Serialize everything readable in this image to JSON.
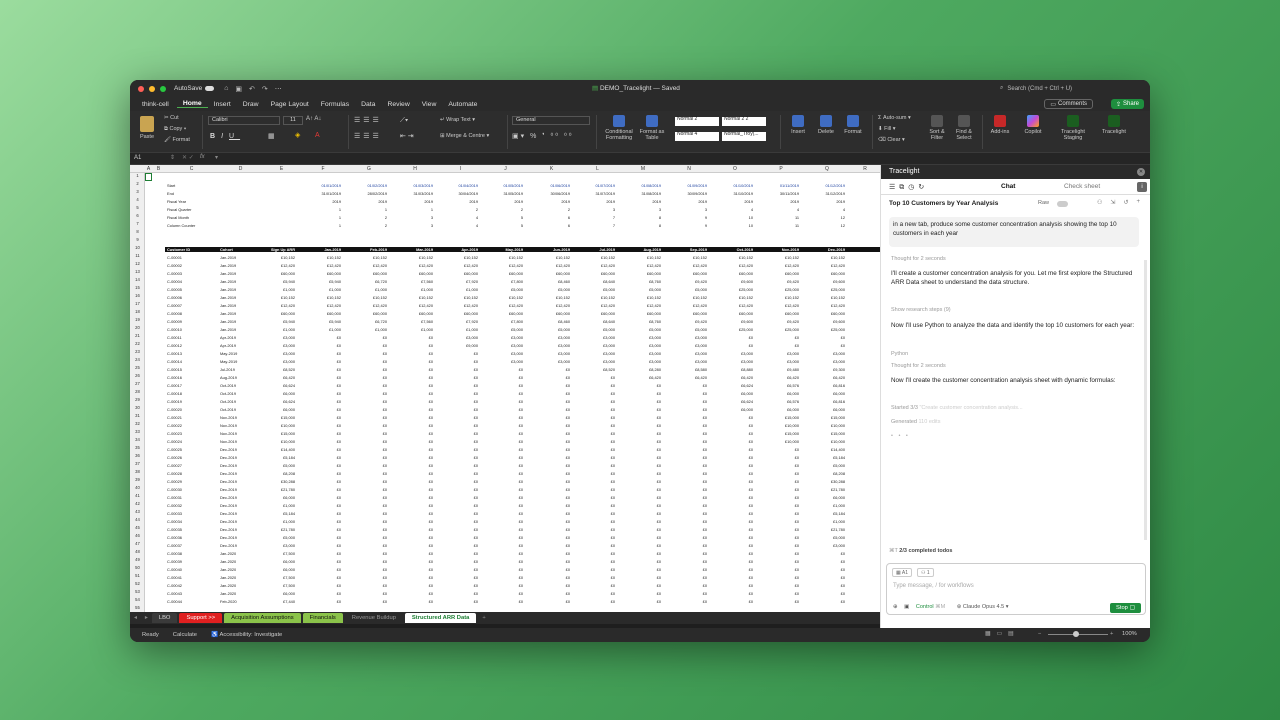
{
  "titlebar": {
    "autosave": "AutoSave",
    "doc_title": "DEMO_Tracelight — Saved",
    "search": "Search (Cmd + Ctrl + U)"
  },
  "menu": {
    "account": "think-cell",
    "items": [
      "Home",
      "Insert",
      "Draw",
      "Page Layout",
      "Formulas",
      "Data",
      "Review",
      "View",
      "Automate"
    ],
    "active": "Home",
    "comments": "Comments",
    "share": "Share"
  },
  "ribbon": {
    "paste": "Paste",
    "cut": "Cut",
    "copy": "Copy",
    "format": "Format",
    "font": "Calibri",
    "size": "11",
    "wrap_text": "Wrap Text",
    "merge_centre": "Merge & Centre",
    "number_format": "General",
    "conditional": "Conditional Formatting",
    "format_table": "Format as Table",
    "styles": [
      "Normal 2",
      "Normal 2 2",
      "Normal 4",
      "Normal_Troy(..."
    ],
    "insert": "Insert",
    "delete": "Delete",
    "format_cells": "Format",
    "autosum": "Auto-sum",
    "fill": "Fill",
    "clear": "Clear",
    "sort_filter": "Sort & Filter",
    "find_select": "Find & Select",
    "addins": "Add-ins",
    "copilot": "Copilot",
    "tracelight_staging": "Tracelight Staging",
    "tracelight": "Tracelight"
  },
  "formula_bar": {
    "name_box": "A1",
    "fx": "fx"
  },
  "sheet": {
    "columns": [
      "A",
      "B",
      "C",
      "D",
      "E",
      "F",
      "G",
      "H",
      "I",
      "J",
      "K",
      "L",
      "M",
      "N",
      "O",
      "P",
      "Q",
      "R"
    ],
    "top_labels": [
      "Start",
      "End",
      "Fiscal Year",
      "Fiscal Quarter",
      "Fiscal Month",
      "Column Counter"
    ],
    "starts": [
      "01/01/2019",
      "01/02/2019",
      "01/03/2019",
      "01/04/2019",
      "01/05/2019",
      "01/06/2019",
      "01/07/2019",
      "01/08/2019",
      "01/09/2019",
      "01/10/2019",
      "01/11/2019",
      "01/12/2019"
    ],
    "ends": [
      "31/01/2019",
      "28/02/2019",
      "31/03/2019",
      "30/04/2019",
      "31/05/2019",
      "30/06/2019",
      "31/07/2019",
      "31/08/2019",
      "30/09/2019",
      "31/10/2019",
      "30/11/2019",
      "31/12/2019"
    ],
    "fiscal_year": [
      "2019",
      "2019",
      "2019",
      "2019",
      "2019",
      "2019",
      "2019",
      "2019",
      "2019",
      "2019",
      "2019",
      "2019"
    ],
    "fiscal_quarter": [
      "1",
      "1",
      "1",
      "2",
      "2",
      "2",
      "3",
      "3",
      "3",
      "4",
      "4",
      "4"
    ],
    "fiscal_month": [
      "1",
      "2",
      "3",
      "4",
      "5",
      "6",
      "7",
      "8",
      "9",
      "10",
      "11",
      "12"
    ],
    "column_counter": [
      "1",
      "2",
      "3",
      "4",
      "5",
      "6",
      "7",
      "8",
      "9",
      "10",
      "11",
      "12"
    ],
    "header": [
      "Customer ID",
      "Cohort",
      "Sign Up ARR",
      "Jan-2019",
      "Feb-2019",
      "Mar-2019",
      "Apr-2019",
      "May-2019",
      "Jun-2019",
      "Jul-2019",
      "Aug-2019",
      "Sep-2019",
      "Oct-2019",
      "Nov-2019",
      "Dec-2019"
    ],
    "rows": [
      [
        "C-00001",
        "Jan-2019",
        "£10,152",
        "£10,152",
        "£10,152",
        "£10,152",
        "£10,152",
        "£10,152",
        "£10,152",
        "£10,152",
        "£10,152",
        "£10,152",
        "£10,152",
        "£10,152",
        "£10,152"
      ],
      [
        "C-00002",
        "Jan-2019",
        "£12,420",
        "£12,420",
        "£12,420",
        "£12,420",
        "£12,420",
        "£12,420",
        "£12,420",
        "£12,420",
        "£12,420",
        "£12,420",
        "£12,420",
        "£12,420",
        "£12,420"
      ],
      [
        "C-00003",
        "Jan-2019",
        "£60,000",
        "£60,000",
        "£60,000",
        "£60,000",
        "£60,000",
        "£60,000",
        "£60,000",
        "£60,000",
        "£60,000",
        "£60,000",
        "£60,000",
        "£60,000",
        "£60,000"
      ],
      [
        "C-00004",
        "Jan-2019",
        "£5,940",
        "£5,940",
        "£6,720",
        "£7,560",
        "£7,920",
        "£7,800",
        "£8,460",
        "£8,640",
        "£8,760",
        "£9,420",
        "£9,600",
        "£9,420",
        "£9,600"
      ],
      [
        "C-00005",
        "Jan-2019",
        "£1,000",
        "£1,000",
        "£1,000",
        "£1,000",
        "£1,000",
        "£5,000",
        "£5,000",
        "£5,000",
        "£5,000",
        "£5,000",
        "£25,000",
        "£25,000",
        "£25,000"
      ],
      [
        "C-00006",
        "Jan-2019",
        "£10,152",
        "£10,152",
        "£10,152",
        "£10,152",
        "£10,152",
        "£10,152",
        "£10,152",
        "£10,152",
        "£10,152",
        "£10,152",
        "£10,152",
        "£10,152",
        "£10,152"
      ],
      [
        "C-00007",
        "Jan-2019",
        "£12,420",
        "£12,420",
        "£12,420",
        "£12,420",
        "£12,420",
        "£12,420",
        "£12,420",
        "£12,420",
        "£12,420",
        "£12,420",
        "£12,420",
        "£12,420",
        "£12,420"
      ],
      [
        "C-00008",
        "Jan-2019",
        "£60,000",
        "£60,000",
        "£60,000",
        "£60,000",
        "£60,000",
        "£60,000",
        "£60,000",
        "£60,000",
        "£60,000",
        "£60,000",
        "£60,000",
        "£60,000",
        "£60,000"
      ],
      [
        "C-00009",
        "Jan-2019",
        "£5,940",
        "£5,940",
        "£6,720",
        "£7,560",
        "£7,920",
        "£7,800",
        "£8,460",
        "£8,640",
        "£8,760",
        "£9,420",
        "£9,600",
        "£9,420",
        "£9,600"
      ],
      [
        "C-00010",
        "Jan-2019",
        "£1,000",
        "£1,000",
        "£1,000",
        "£1,000",
        "£1,000",
        "£5,000",
        "£5,000",
        "£5,000",
        "£5,000",
        "£5,000",
        "£25,000",
        "£25,000",
        "£25,000"
      ],
      [
        "C-00011",
        "Apr-2019",
        "£3,000",
        "£0",
        "£0",
        "£0",
        "£3,000",
        "£3,000",
        "£3,000",
        "£3,000",
        "£3,000",
        "£3,000",
        "£0",
        "£0",
        "£0"
      ],
      [
        "C-00012",
        "Apr-2019",
        "£3,000",
        "£0",
        "£0",
        "£0",
        "£9,000",
        "£3,000",
        "£3,000",
        "£3,000",
        "£3,000",
        "£3,000",
        "£0",
        "£0",
        "£0"
      ],
      [
        "C-00013",
        "May-2019",
        "£3,000",
        "£0",
        "£0",
        "£0",
        "£0",
        "£3,000",
        "£3,000",
        "£3,000",
        "£3,000",
        "£3,000",
        "£3,000",
        "£3,000",
        "£3,000"
      ],
      [
        "C-00014",
        "May-2019",
        "£3,000",
        "£0",
        "£0",
        "£0",
        "£0",
        "£3,000",
        "£3,000",
        "£3,000",
        "£3,000",
        "£3,000",
        "£3,000",
        "£3,000",
        "£3,000"
      ],
      [
        "C-00015",
        "Jul-2019",
        "£8,520",
        "£0",
        "£0",
        "£0",
        "£0",
        "£0",
        "£0",
        "£8,520",
        "£8,280",
        "£8,580",
        "£8,880",
        "£9,480",
        "£9,300"
      ],
      [
        "C-00016",
        "Aug-2019",
        "£6,420",
        "£0",
        "£0",
        "£0",
        "£0",
        "£0",
        "£0",
        "£0",
        "£6,420",
        "£6,420",
        "£6,420",
        "£6,420",
        "£6,420"
      ],
      [
        "C-00017",
        "Oct-2019",
        "£6,624",
        "£0",
        "£0",
        "£0",
        "£0",
        "£0",
        "£0",
        "£0",
        "£0",
        "£0",
        "£6,624",
        "£6,576",
        "£6,816"
      ],
      [
        "C-00018",
        "Oct-2019",
        "£6,000",
        "£0",
        "£0",
        "£0",
        "£0",
        "£0",
        "£0",
        "£0",
        "£0",
        "£0",
        "£6,000",
        "£6,000",
        "£6,000"
      ],
      [
        "C-00019",
        "Oct-2019",
        "£6,624",
        "£0",
        "£0",
        "£0",
        "£0",
        "£0",
        "£0",
        "£0",
        "£0",
        "£0",
        "£6,624",
        "£6,576",
        "£6,816"
      ],
      [
        "C-00020",
        "Oct-2019",
        "£6,000",
        "£0",
        "£0",
        "£0",
        "£0",
        "£0",
        "£0",
        "£0",
        "£0",
        "£0",
        "£6,000",
        "£6,000",
        "£6,000"
      ],
      [
        "C-00021",
        "Nov-2019",
        "£15,000",
        "£0",
        "£0",
        "£0",
        "£0",
        "£0",
        "£0",
        "£0",
        "£0",
        "£0",
        "£0",
        "£15,000",
        "£15,000"
      ],
      [
        "C-00022",
        "Nov-2019",
        "£10,000",
        "£0",
        "£0",
        "£0",
        "£0",
        "£0",
        "£0",
        "£0",
        "£0",
        "£0",
        "£0",
        "£10,000",
        "£10,000"
      ],
      [
        "C-00023",
        "Nov-2019",
        "£15,000",
        "£0",
        "£0",
        "£0",
        "£0",
        "£0",
        "£0",
        "£0",
        "£0",
        "£0",
        "£0",
        "£15,000",
        "£15,000"
      ],
      [
        "C-00024",
        "Nov-2019",
        "£10,000",
        "£0",
        "£0",
        "£0",
        "£0",
        "£0",
        "£0",
        "£0",
        "£0",
        "£0",
        "£0",
        "£10,000",
        "£10,000"
      ],
      [
        "C-00025",
        "Dec-2019",
        "£14,400",
        "£0",
        "£0",
        "£0",
        "£0",
        "£0",
        "£0",
        "£0",
        "£0",
        "£0",
        "£0",
        "£0",
        "£14,400"
      ],
      [
        "C-00026",
        "Dec-2019",
        "£5,184",
        "£0",
        "£0",
        "£0",
        "£0",
        "£0",
        "£0",
        "£0",
        "£0",
        "£0",
        "£0",
        "£0",
        "£5,184"
      ],
      [
        "C-00027",
        "Dec-2019",
        "£5,000",
        "£0",
        "£0",
        "£0",
        "£0",
        "£0",
        "£0",
        "£0",
        "£0",
        "£0",
        "£0",
        "£0",
        "£5,000"
      ],
      [
        "C-00028",
        "Dec-2019",
        "£8,208",
        "£0",
        "£0",
        "£0",
        "£0",
        "£0",
        "£0",
        "£0",
        "£0",
        "£0",
        "£0",
        "£0",
        "£8,208"
      ],
      [
        "C-00029",
        "Dec-2019",
        "£30,288",
        "£0",
        "£0",
        "£0",
        "£0",
        "£0",
        "£0",
        "£0",
        "£0",
        "£0",
        "£0",
        "£0",
        "£30,288"
      ],
      [
        "C-00030",
        "Dec-2019",
        "£21,780",
        "£0",
        "£0",
        "£0",
        "£0",
        "£0",
        "£0",
        "£0",
        "£0",
        "£0",
        "£0",
        "£0",
        "£21,780"
      ],
      [
        "C-00031",
        "Dec-2019",
        "£6,000",
        "£0",
        "£0",
        "£0",
        "£0",
        "£0",
        "£0",
        "£0",
        "£0",
        "£0",
        "£0",
        "£0",
        "£6,000"
      ],
      [
        "C-00032",
        "Dec-2019",
        "£1,000",
        "£0",
        "£0",
        "£0",
        "£0",
        "£0",
        "£0",
        "£0",
        "£0",
        "£0",
        "£0",
        "£0",
        "£1,000"
      ],
      [
        "C-00033",
        "Dec-2019",
        "£5,184",
        "£0",
        "£0",
        "£0",
        "£0",
        "£0",
        "£0",
        "£0",
        "£0",
        "£0",
        "£0",
        "£0",
        "£5,184"
      ],
      [
        "C-00034",
        "Dec-2019",
        "£1,000",
        "£0",
        "£0",
        "£0",
        "£0",
        "£0",
        "£0",
        "£0",
        "£0",
        "£0",
        "£0",
        "£0",
        "£1,000"
      ],
      [
        "C-00035",
        "Dec-2019",
        "£21,780",
        "£0",
        "£0",
        "£0",
        "£0",
        "£0",
        "£0",
        "£0",
        "£0",
        "£0",
        "£0",
        "£0",
        "£21,780"
      ],
      [
        "C-00036",
        "Dec-2019",
        "£5,000",
        "£0",
        "£0",
        "£0",
        "£0",
        "£0",
        "£0",
        "£0",
        "£0",
        "£0",
        "£0",
        "£0",
        "£5,000"
      ],
      [
        "C-00037",
        "Dec-2019",
        "£3,000",
        "£0",
        "£0",
        "£0",
        "£0",
        "£0",
        "£0",
        "£0",
        "£0",
        "£0",
        "£0",
        "£0",
        "£3,000"
      ],
      [
        "C-00038",
        "Jan-2020",
        "£7,500",
        "£0",
        "£0",
        "£0",
        "£0",
        "£0",
        "£0",
        "£0",
        "£0",
        "£0",
        "£0",
        "£0",
        "£0"
      ],
      [
        "C-00039",
        "Jan-2020",
        "£6,000",
        "£0",
        "£0",
        "£0",
        "£0",
        "£0",
        "£0",
        "£0",
        "£0",
        "£0",
        "£0",
        "£0",
        "£0"
      ],
      [
        "C-00040",
        "Jan-2020",
        "£6,000",
        "£0",
        "£0",
        "£0",
        "£0",
        "£0",
        "£0",
        "£0",
        "£0",
        "£0",
        "£0",
        "£0",
        "£0"
      ],
      [
        "C-00041",
        "Jan-2020",
        "£7,500",
        "£0",
        "£0",
        "£0",
        "£0",
        "£0",
        "£0",
        "£0",
        "£0",
        "£0",
        "£0",
        "£0",
        "£0"
      ],
      [
        "C-00042",
        "Jan-2020",
        "£7,500",
        "£0",
        "£0",
        "£0",
        "£0",
        "£0",
        "£0",
        "£0",
        "£0",
        "£0",
        "£0",
        "£0",
        "£0"
      ],
      [
        "C-00043",
        "Jan-2020",
        "£6,000",
        "£0",
        "£0",
        "£0",
        "£0",
        "£0",
        "£0",
        "£0",
        "£0",
        "£0",
        "£0",
        "£0",
        "£0"
      ],
      [
        "C-00044",
        "Feb-2020",
        "£7,440",
        "£0",
        "£0",
        "£0",
        "£0",
        "£0",
        "£0",
        "£0",
        "£0",
        "£0",
        "£0",
        "£0",
        "£0"
      ]
    ]
  },
  "sheet_tabs": [
    {
      "label": "LBO",
      "bg": "#3a3a3a",
      "fg": "#ddd"
    },
    {
      "label": "Support >>",
      "bg": "#e02020",
      "fg": "#fff"
    },
    {
      "label": "Acquisition Assumptions",
      "bg": "#8bc34a",
      "fg": "#111"
    },
    {
      "label": "Financials",
      "bg": "#8bc34a",
      "fg": "#111"
    },
    {
      "label": "Revenue Buildup",
      "bg": "#2a2a2a",
      "fg": "#999"
    },
    {
      "label": "Structured ARR Data",
      "bg": "#ffffff",
      "fg": "#1e7e34"
    }
  ],
  "status": {
    "ready": "Ready",
    "calculate": "Calculate",
    "accessibility": "Accessibility: Investigate",
    "zoom": "100%"
  },
  "panel": {
    "title": "Tracelight",
    "tab_chat": "Chat",
    "tab_check": "Check sheet",
    "analysis_title": "Top 10 Customers by Year Analysis",
    "raw": "Raw",
    "user_message": "in a new tab, produce some customer concentration analysis showing the top 10 customers in each year",
    "thought1": "Thought for 2 seconds",
    "msg1": "I'll create a customer concentration analysis for you. Let me first explore the Structured ARR Data sheet to understand the data structure.",
    "research": "Show research steps (9)",
    "msg2": "Now I'll use Python to analyze the data and identify the top 10 customers for each year:",
    "python": "Python",
    "thought2": "Thought for 2 seconds",
    "msg3": "Now I'll create the customer concentration analysis sheet with dynamic formulas:",
    "started": "Started 3/3",
    "started_detail": "\"Create customer concentration analysis...",
    "generated": "Generated",
    "generated_detail": "110 edits",
    "todos": "2/3 completed todos",
    "todos_prefix": "⌘T",
    "chip_cell": "A1",
    "chip_count": "1",
    "placeholder": "Type message, / for workflows",
    "mode": "Control",
    "mode_shortcut": "⌘M",
    "model": "Claude Opus 4.5",
    "stop": "Stop"
  }
}
